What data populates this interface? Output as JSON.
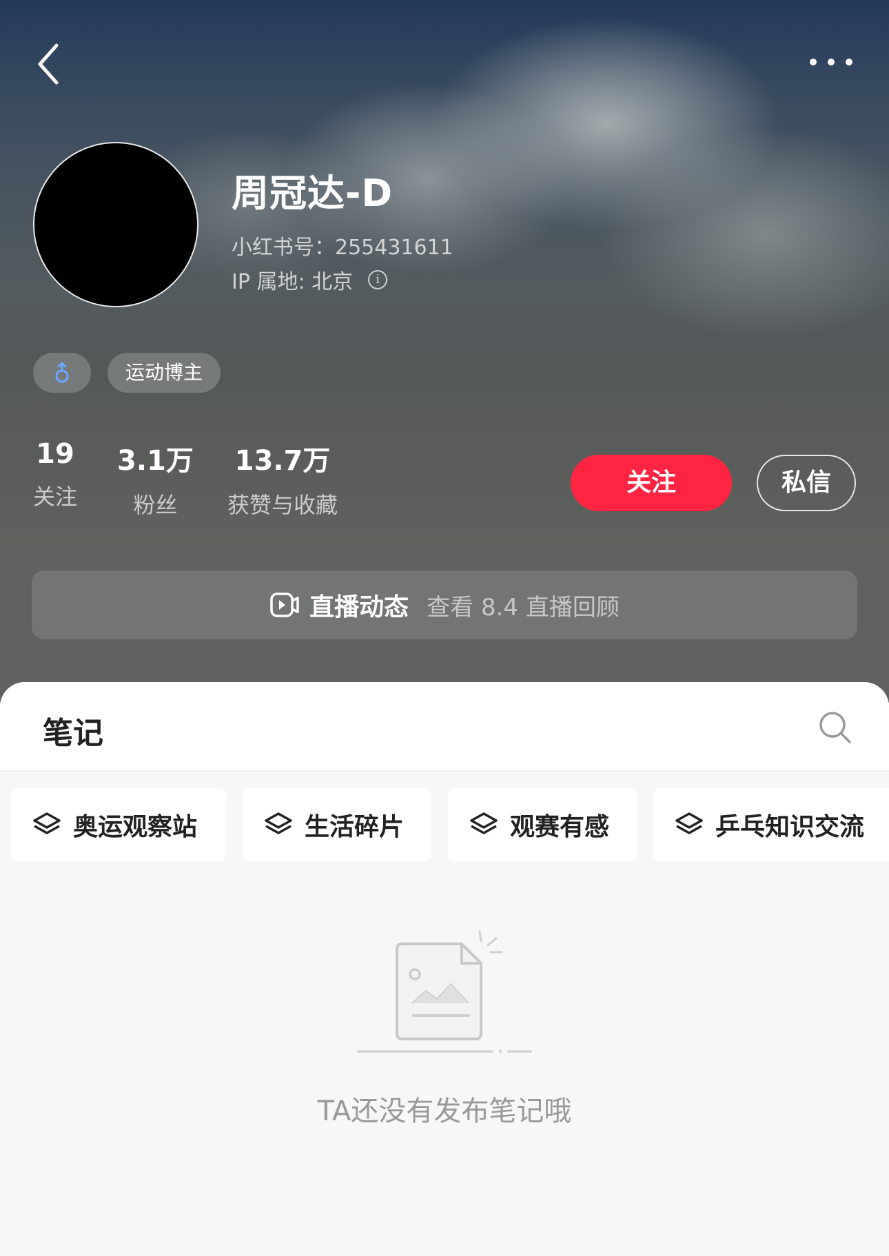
{
  "profile": {
    "nickname": "周冠达-D",
    "account_id": "小红书号：255431611",
    "ip_location": "IP 属地: 北京",
    "gender_icon": "male-symbol",
    "tag": "运动博主"
  },
  "stats": [
    {
      "value": "19",
      "label": "关注"
    },
    {
      "value": "3.1万",
      "label": "粉丝"
    },
    {
      "value": "13.7万",
      "label": "获赞与收藏"
    }
  ],
  "actions": {
    "follow_label": "关注",
    "message_label": "私信"
  },
  "live": {
    "title": "直播动态",
    "subtitle": "查看 8.4 直播回顾"
  },
  "notes": {
    "tab_label": "笔记",
    "collections": [
      {
        "label": "奥运观察站"
      },
      {
        "label": "生活碎片"
      },
      {
        "label": "观赛有感"
      },
      {
        "label": "乒乓知识交流"
      }
    ],
    "empty_text": "TA还没有发布笔记哦"
  },
  "colors": {
    "accent": "#ff2442",
    "gender_icon": "#6aa7ff"
  }
}
